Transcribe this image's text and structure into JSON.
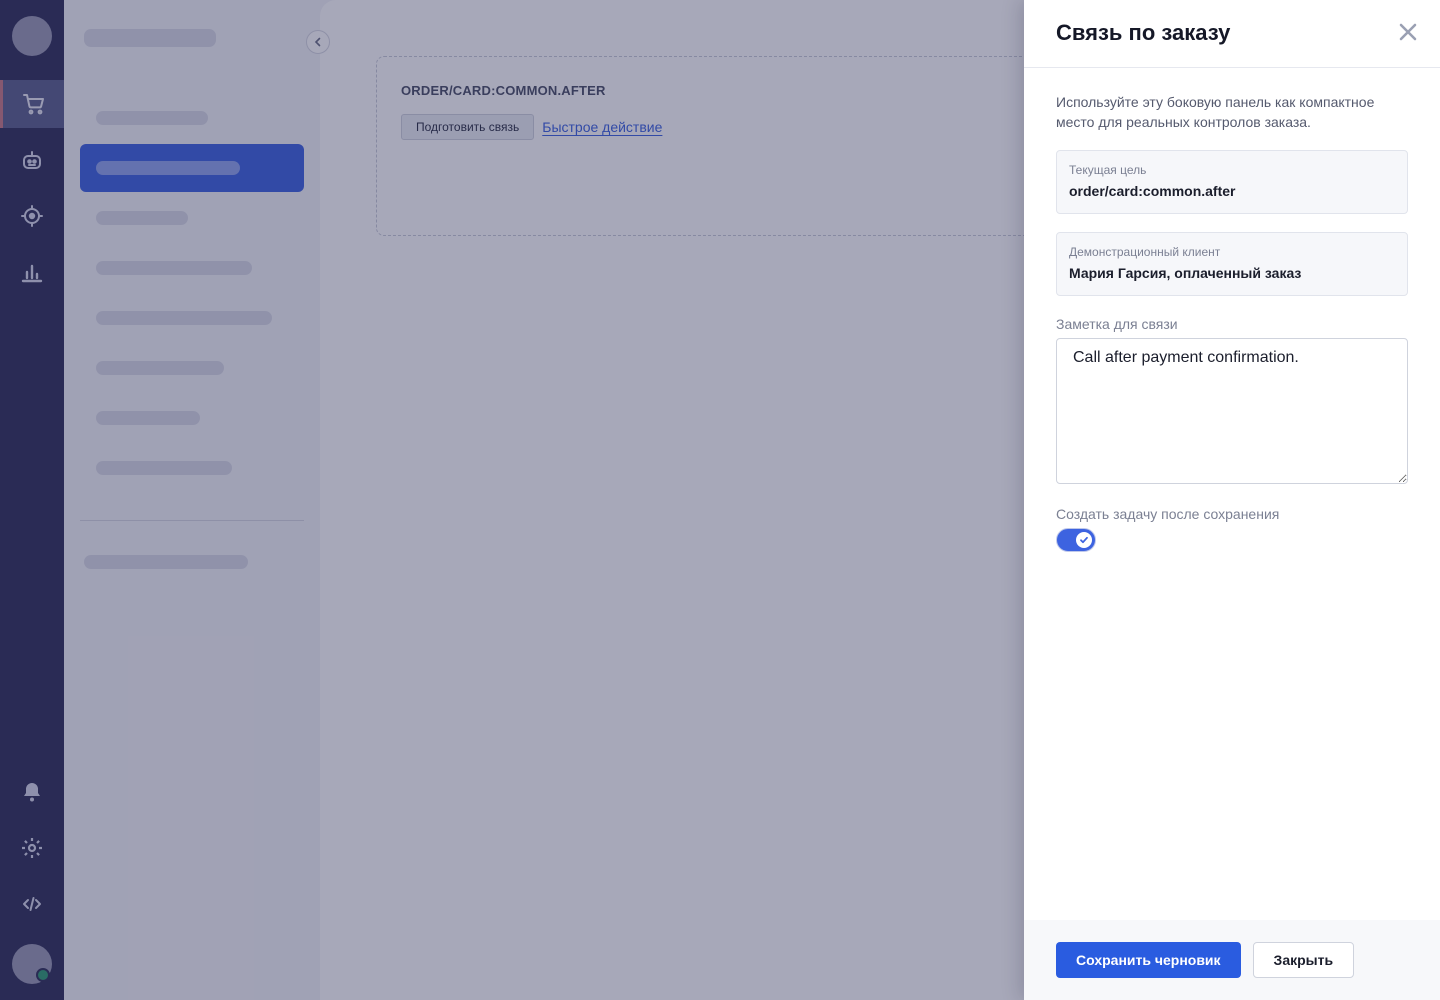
{
  "rail": {
    "icons": [
      "cart-icon",
      "robot-icon",
      "target-icon",
      "chart-icon",
      "bell-icon",
      "gear-icon",
      "code-icon"
    ]
  },
  "slot": {
    "title": "ORDER/CARD:COMMON.AFTER",
    "prepare_button": "Подготовить связь",
    "quick_action_link": "Быстрое действие"
  },
  "panel": {
    "title": "Связь по заказу",
    "description": "Используйте эту боковую панель как компактное место для реальных контролов заказа.",
    "current_target": {
      "label": "Текущая цель",
      "value": "order/card:common.after"
    },
    "demo_client": {
      "label": "Демонстрационный клиент",
      "value": "Мария Гарсия, оплаченный заказ"
    },
    "note": {
      "label": "Заметка для связи",
      "value": "Call after payment confirmation."
    },
    "toggle": {
      "label": "Создать задачу после сохранения",
      "checked": true
    },
    "save_button": "Сохранить черновик",
    "close_button": "Закрыть"
  },
  "colors": {
    "rail": "#2f3059",
    "accent": "#3d63e0",
    "primary_button": "#2a5ce0"
  }
}
